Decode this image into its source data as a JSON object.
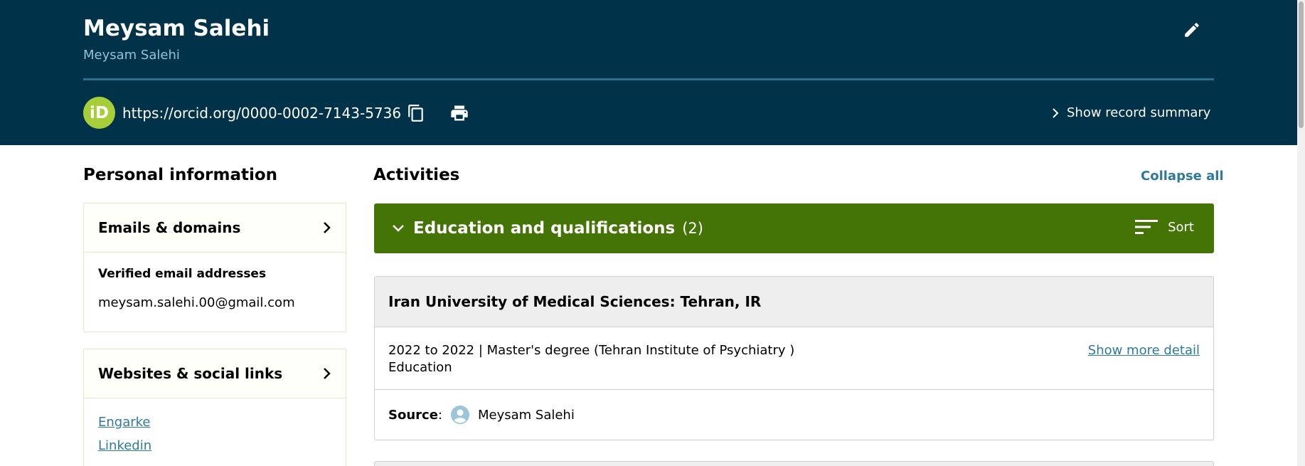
{
  "header": {
    "name": "Meysam Salehi",
    "subname": "Meysam Salehi",
    "orcid_logo_text": "iD",
    "orcid_url": "https://orcid.org/0000-0002-7143-5736",
    "record_summary_label": "Show record summary",
    "icons": {
      "edit": "pencil-icon",
      "copy": "copy-icon",
      "print": "printer-icon",
      "chevron": "chevron-right-icon"
    }
  },
  "personal": {
    "title": "Personal information",
    "emails": {
      "title": "Emails & domains",
      "verified_label": "Verified email addresses",
      "email": "meysam.salehi.00@gmail.com"
    },
    "websites": {
      "title": "Websites & social links",
      "links": [
        "Engarke",
        "Linkedin"
      ]
    }
  },
  "activities": {
    "title": "Activities",
    "collapse_all": "Collapse all",
    "education": {
      "title": "Education and qualifications",
      "count": "(2)",
      "sort_label": "Sort",
      "entries": [
        {
          "title": "Iran University of Medical Sciences: Tehran, IR",
          "line1": "2022 to 2022 | Master's degree (Tehran Institute of Psychiatry )",
          "line2": "Education",
          "show_more": "Show more detail",
          "source_label": "Source",
          "source_name": "Meysam Salehi"
        }
      ]
    }
  },
  "colors": {
    "header_bg": "#003249",
    "orcid_green": "#a6ce39",
    "education_bar": "#447405",
    "link": "#2e7a9a"
  }
}
